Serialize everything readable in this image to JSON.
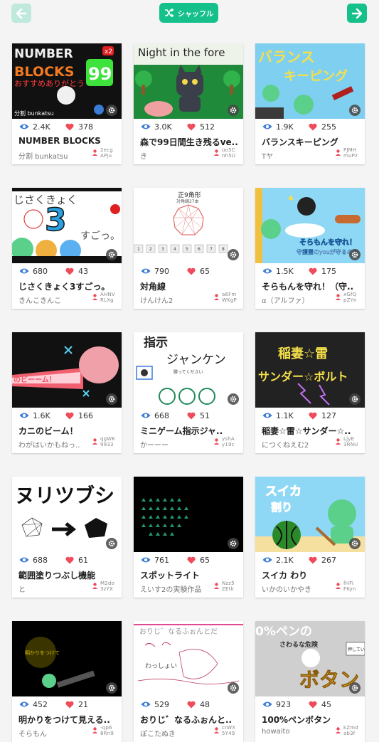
{
  "header": {
    "shuffle_label": "シャッフル",
    "accent": "#16c08a",
    "disabled_accent": "#bfe9dd"
  },
  "icons": {
    "back": "arrow-left-icon",
    "next": "arrow-right-icon",
    "shuffle": "shuffle-icon",
    "views": "eye-icon",
    "likes": "heart-icon",
    "settings": "gear-icon",
    "author": "user-pin-icon"
  },
  "cards": [
    {
      "views": "2.4K",
      "likes": "378",
      "title": "NUMBER BLOCKS",
      "author": "分割 bunkatsu",
      "code": "2ecg\nAPju",
      "thumb_text": [
        "NUMBER",
        "BLOCKS",
        "おすすめありがとう",
        "99",
        "x2",
        "分割 bunkatsu"
      ]
    },
    {
      "views": "3.0K",
      "likes": "512",
      "title": "森で99日間生き残るve..",
      "author": "き",
      "code": "uo5C\nnh5U",
      "thumb_text": [
        "Night in the fore"
      ]
    },
    {
      "views": "1.9K",
      "likes": "255",
      "title": "バランスキーピング",
      "author": "Tヤ",
      "code": "PJMH\nmuPz",
      "thumb_text": [
        "バランス",
        "キーピング"
      ]
    },
    {
      "views": "680",
      "likes": "43",
      "title": "じさくきょく3すごっ。",
      "author": "きんこきんこ",
      "code": "AHNV\nRLXg",
      "thumb_text": [
        "じさくきょく",
        "3",
        "すごっ。"
      ]
    },
    {
      "views": "790",
      "likes": "65",
      "title": "対角線",
      "author": "けんけん2",
      "code": "a6Fm\nWKgP",
      "thumb_text": [
        "正9角形",
        "対角線27本",
        "1",
        "2",
        "3",
        "4",
        "5",
        "6",
        "7",
        "8"
      ]
    },
    {
      "views": "1.5K",
      "likes": "175",
      "title": "そらもんを守れ！（守..",
      "author": "α（アルファ）",
      "code": "xGfQ\npZYn",
      "thumb_text": [
        "そらもんを守れ！",
        "守護霊のyouが守るのだ"
      ]
    },
    {
      "views": "1.6K",
      "likes": "166",
      "title": "カニのビーム！",
      "author": "わがはいかもねっ..",
      "code": "qgWK\n9933",
      "thumb_text": [
        "のビーーム！"
      ]
    },
    {
      "views": "668",
      "likes": "51",
      "title": "ミニゲーム指示ジャ..",
      "author": "かーーー",
      "code": "yshA\ny19c",
      "thumb_text": [
        "指示",
        "ジャンケン",
        "勝ってください"
      ]
    },
    {
      "views": "1.1K",
      "likes": "127",
      "title": "稲妻☆雷☆サンダー☆..",
      "author": "につくねえむ2",
      "code": "LjyE\n3RNU",
      "thumb_text": [
        "稲妻☆雷",
        "サンダー☆ボルト"
      ]
    },
    {
      "views": "688",
      "likes": "61",
      "title": "範囲塗りつぶし機能",
      "author": "と",
      "code": "M2do\n3zYX",
      "thumb_text": [
        "ヌリツブシ"
      ]
    },
    {
      "views": "761",
      "likes": "65",
      "title": "スポットライト",
      "author": "えいす2の実験作品",
      "code": "Nzz5\nZEtk",
      "thumb_text": []
    },
    {
      "views": "2.1K",
      "likes": "267",
      "title": "スイカ わり",
      "author": "いかのいかやき",
      "code": "fHFi\nFKyn",
      "thumb_text": [
        "スイカ",
        "割り"
      ]
    },
    {
      "views": "452",
      "likes": "21",
      "title": "明かりをつけて見える..",
      "author": "そらもん",
      "code": "-qp6\n8Rn9",
      "thumb_text": [
        "明かりをつけて"
      ]
    },
    {
      "views": "529",
      "likes": "48",
      "title": "おりじ゛なるふぉんと..",
      "author": "ぽこたぬき",
      "code": "crWX\n5Y49",
      "thumb_text": [
        "おりじ゛なるふぉんとだ",
        "わっしょい"
      ]
    },
    {
      "views": "923",
      "likes": "45",
      "title": "100%ペンボタン",
      "author": "howaito",
      "code": "kZmd\nab3f",
      "thumb_text": [
        "0%ペンの",
        "さわるな危険",
        "ボタン",
        "押してい"
      ]
    }
  ]
}
